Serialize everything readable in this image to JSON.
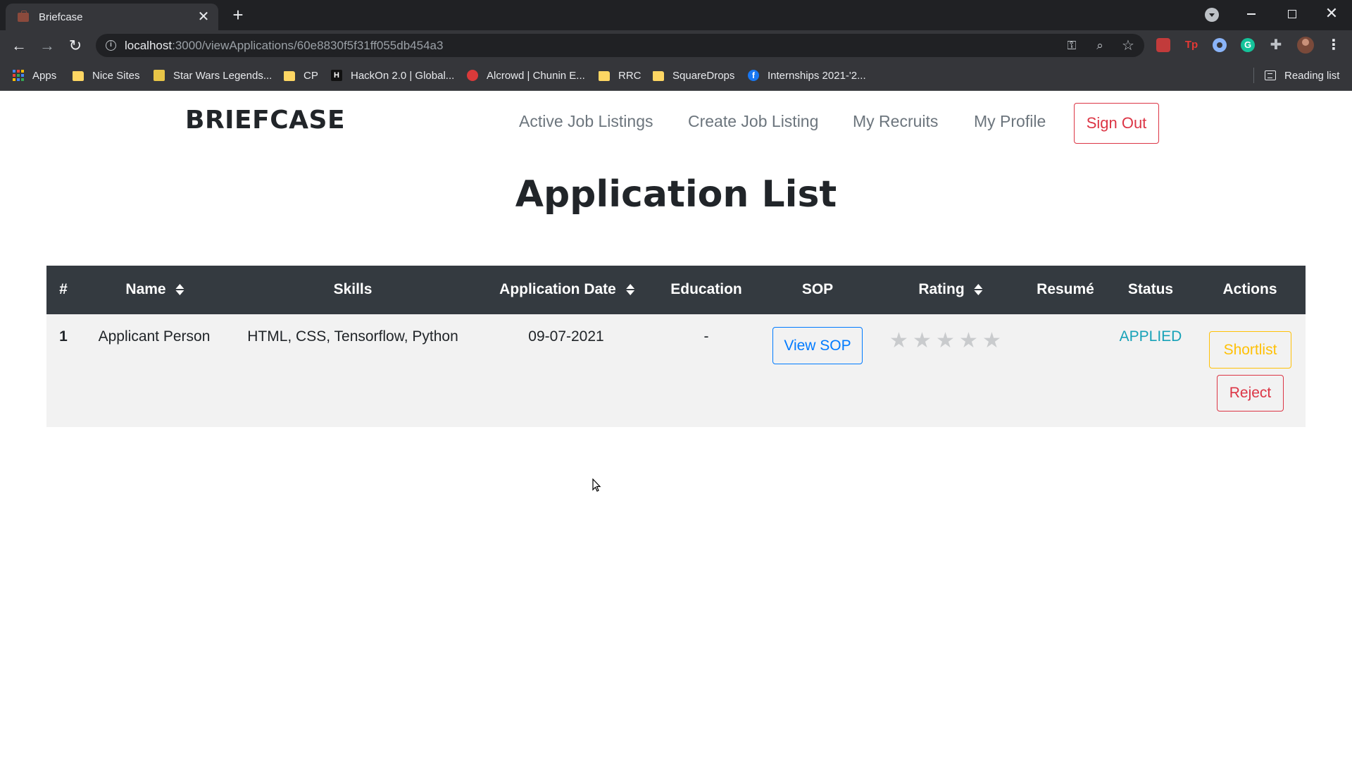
{
  "browser": {
    "tab_title": "Briefcase",
    "tab_close": "✕",
    "new_tab": "+",
    "url_host": "localhost",
    "url_path": ":3000/viewApplications/60e8830f5f31ff055db454a3",
    "bookmarks": [
      {
        "label": "Apps",
        "icon": "apps-grid-icon"
      },
      {
        "label": "Nice Sites",
        "icon": "folder-icon"
      },
      {
        "label": "Star Wars Legends...",
        "icon": "star-wars-icon"
      },
      {
        "label": "CP",
        "icon": "folder-icon"
      },
      {
        "label": "HackOn 2.0 | Global...",
        "icon": "hackon-icon"
      },
      {
        "label": "Alcrowd | Chunin E...",
        "icon": "aicrowd-icon"
      },
      {
        "label": "RRC",
        "icon": "folder-icon"
      },
      {
        "label": "SquareDrops",
        "icon": "folder-icon"
      },
      {
        "label": "Internships 2021-'2...",
        "icon": "facebook-icon"
      }
    ],
    "reading_list": "Reading list"
  },
  "navbar": {
    "brand": "BRIEFCASE",
    "links": [
      "Active Job Listings",
      "Create Job Listing",
      "My Recruits",
      "My Profile"
    ],
    "sign_out": "Sign Out"
  },
  "page": {
    "title": "Application List"
  },
  "table": {
    "headers": [
      "#",
      "Name",
      "Skills",
      "Application Date",
      "Education",
      "SOP",
      "Rating",
      "Resumé",
      "Status",
      "Actions"
    ],
    "sortable": [
      "Name",
      "Application Date",
      "Rating"
    ],
    "rows": [
      {
        "index": "1",
        "name": "Applicant Person",
        "skills": "HTML, CSS, Tensorflow, Python",
        "application_date": "09-07-2021",
        "education": "-",
        "sop_button": "View SOP",
        "rating": 0,
        "rating_max": 5,
        "resume": "",
        "status": "APPLIED",
        "actions": {
          "shortlist": "Shortlist",
          "reject": "Reject"
        }
      }
    ]
  },
  "colors": {
    "header_bg": "#343a40",
    "row_bg": "#f2f2f2",
    "status": "#17a2b8",
    "primary": "#007bff",
    "warning": "#ffc107",
    "danger": "#dc3545"
  }
}
